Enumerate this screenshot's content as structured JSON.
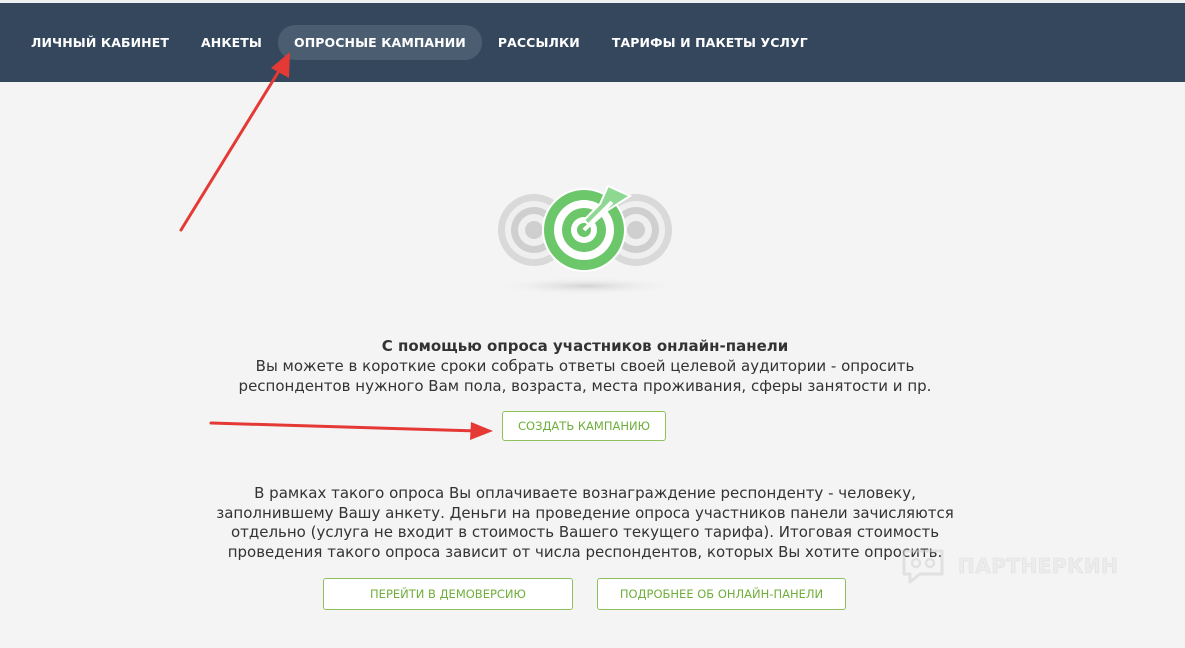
{
  "nav": {
    "items": [
      {
        "label": "ЛИЧНЫЙ КАБИНЕТ",
        "active": false
      },
      {
        "label": "АНКЕТЫ",
        "active": false
      },
      {
        "label": "ОПРОСНЫЕ КАМПАНИИ",
        "active": true
      },
      {
        "label": "РАССЫЛКИ",
        "active": false
      },
      {
        "label": "ТАРИФЫ И ПАКЕТЫ УСЛУГ",
        "active": false
      }
    ]
  },
  "hero": {
    "icon": "target-icon",
    "title": "С помощью опроса участников онлайн-панели",
    "line1": "Вы можете в короткие сроки собрать ответы своей целевой аудитории - опросить",
    "line2": "респондентов нужного Вам пола, возраста, места проживания, сферы занятости и пр."
  },
  "actions": {
    "create_label": "СОЗДАТЬ КАМПАНИЮ",
    "demo_label": "ПЕРЕЙТИ В ДЕМОВЕРСИЮ",
    "more_label": "ПОДРОБНЕЕ ОБ ОНЛАЙН-ПАНЕЛИ"
  },
  "info": {
    "line1": "В рамках такого опроса Вы оплачиваете вознаграждение респонденту - человеку,",
    "line2": "заполнившему Вашу анкету. Деньги на проведение опроса участников панели зачисляются",
    "line3": "отдельно (услуга не входит в стоимость Вашего текущего тарифа). Итоговая стоимость",
    "line4": "проведения такого опроса зависит от числа респондентов, которых Вы хотите опросить."
  },
  "watermark": {
    "text": "ПАРТНЕРКИН"
  },
  "colors": {
    "nav_bg": "#34475d",
    "nav_active": "#4b5d71",
    "accent_green": "#6fae3a",
    "annotation_red": "#e53935"
  }
}
